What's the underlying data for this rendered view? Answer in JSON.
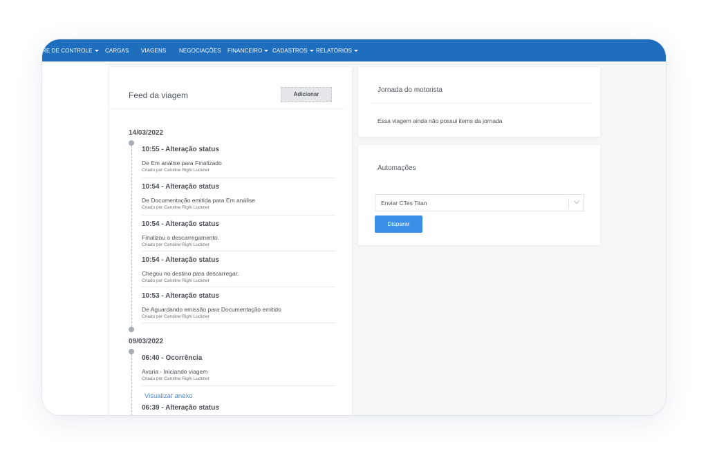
{
  "navbar": {
    "items": [
      {
        "label": "RE DE CONTROLE",
        "dropdown": true
      },
      {
        "label": "CARGAS",
        "dropdown": false
      },
      {
        "label": "VIAGENS",
        "dropdown": false
      },
      {
        "label": "NEGOCIAÇÕES",
        "dropdown": false
      },
      {
        "label": "FINANCEIRO",
        "dropdown": true
      },
      {
        "label": "CADASTROS",
        "dropdown": true
      },
      {
        "label": "RELATÓRIOS",
        "dropdown": true
      }
    ]
  },
  "feed": {
    "title": "Feed da viagem",
    "add_label": "Adicionar",
    "groups": [
      {
        "date": "14/03/2022",
        "entries": [
          {
            "title": "10:55 - Alteração status",
            "description": "De Em análise para Finalizado",
            "author": "Criado por Caroline Righi Luckner"
          },
          {
            "title": "10:54 - Alteração status",
            "description": "De Documentação emitida para Em análise",
            "author": "Criado por Caroline Righi Luckner"
          },
          {
            "title": "10:54 - Alteração status",
            "description": "Finalizou o descarregamento.",
            "author": "Criado por Caroline Righi Luckner"
          },
          {
            "title": "10:54 - Alteração status",
            "description": "Chegou no destino para descarregar.",
            "author": "Criado por Caroline Righi Luckner"
          },
          {
            "title": "10:53 - Alteração status",
            "description": "De Aguardando emissão para Documentação emitido",
            "author": "Criado por Caroline Righi Luckner"
          }
        ]
      },
      {
        "date": "09/03/2022",
        "entries": [
          {
            "title": "06:40 - Ocorrência",
            "description": "Avaria - Iniciando viagem",
            "author": "Criado por Caroline Righi Luckner",
            "link": "Visualizar anexo"
          },
          {
            "title": "06:39 - Alteração status"
          }
        ]
      }
    ]
  },
  "jornada": {
    "title": "Jornada do motorista",
    "empty_text": "Essa viagem ainda não possui items da jornada"
  },
  "automacoes": {
    "title": "Automações",
    "select_value": "Enviar CTes Titan",
    "button_label": "Disparar"
  },
  "colors": {
    "navbar": "#1f6dbd",
    "primary_button": "#3a8ee6",
    "link": "#4e86c7"
  }
}
